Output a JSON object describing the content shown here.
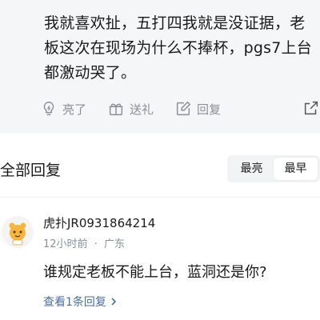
{
  "post": {
    "body": "我就喜欢扯，五打四我就是没证据，老板这次在现场为什么不捧杯，pgs7上台都激动哭了。",
    "actions": [
      {
        "icon": "lightbulb-icon",
        "label": "亮了"
      },
      {
        "icon": "gift-icon",
        "label": "送礼"
      },
      {
        "icon": "edit-reply-icon",
        "label": "回复"
      }
    ],
    "share_icon": "share-icon"
  },
  "replies_section": {
    "title": "全部回复",
    "sort_options": [
      "最亮",
      "最早"
    ],
    "active_sort": "最早"
  },
  "comment": {
    "username": "虎扑JR0931864214",
    "time": "12小时前",
    "separator": "·",
    "location": "广东",
    "text": "谁规定老板不能上台，蓝洞还是你?",
    "view_replies": "查看1条回复"
  },
  "colors": {
    "post_background": "#f5f6f7",
    "muted": "#8a8f99",
    "link": "#4a6fa5",
    "avatar_accent": "#f7b53b"
  }
}
